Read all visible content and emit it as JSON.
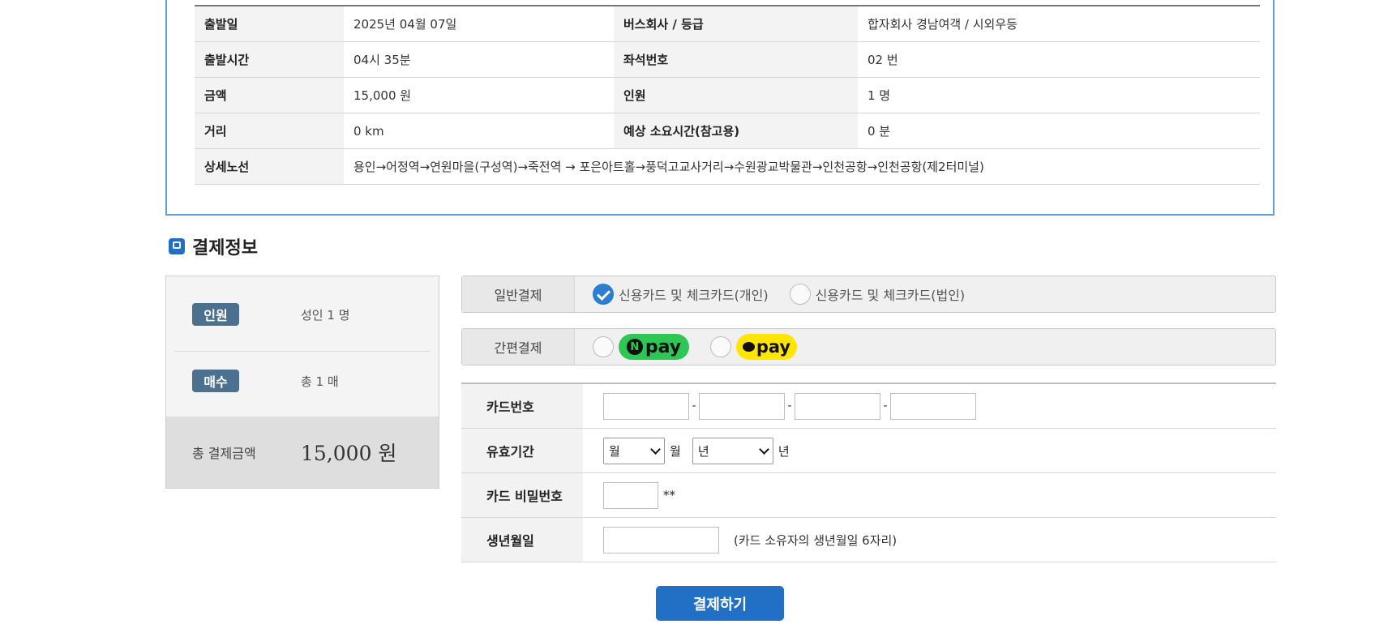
{
  "trip_info": {
    "rows": [
      {
        "l1": "출발일",
        "v1": "2025년 04월 07일",
        "l2": "버스회사 / 등급",
        "v2": "합자회사 경남여객 / 시외우등"
      },
      {
        "l1": "출발시간",
        "v1": "04시 35분",
        "l2": "좌석번호",
        "v2": "02 번"
      },
      {
        "l1": "금액",
        "v1": "15,000 원",
        "l2": "인원",
        "v2": "1 명"
      },
      {
        "l1": "거리",
        "v1": "0 km",
        "l2": "예상 소요시간(참고용)",
        "v2": "0 분"
      }
    ],
    "route_label": "상세노선",
    "route_value": "용인→어정역→연원마을(구성역)→죽전역 → 포은아트홀→풍덕고교사거리→수원광교박물관→인천공항→인천공항(제2터미널)"
  },
  "payment_section": {
    "title": "결제정보",
    "icon": "bus-icon"
  },
  "summary": {
    "people_badge": "인원",
    "people_value": "성인 1 명",
    "count_badge": "매수",
    "count_value": "총 1 매",
    "total_label": "총 결제금액",
    "total_value": "15,000 원"
  },
  "payment_methods": {
    "general_label": "일반결제",
    "option_personal": "신용카드 및 체크카드(개인)",
    "option_corporate": "신용카드 및 체크카드(법인)",
    "selected": "personal",
    "easy_label": "간편결제",
    "npay_text": "pay",
    "npay_n": "N",
    "kakaopay_text": "pay"
  },
  "card_form": {
    "card_number_label": "카드번호",
    "expiry_label": "유효기간",
    "month_select": "월",
    "month_unit": "월",
    "year_select": "년",
    "year_unit": "년",
    "password_label": "카드 비밀번호",
    "password_suffix": "**",
    "birth_label": "생년월일",
    "birth_note": "(카드 소유자의 생년월일 6자리)"
  },
  "submit_label": "결제하기",
  "colors": {
    "accent": "#2170c6",
    "badge": "#4c7090",
    "npay_green": "#2ec655",
    "kakao_yellow": "#ffe600",
    "box_border": "#5aa0dc"
  }
}
